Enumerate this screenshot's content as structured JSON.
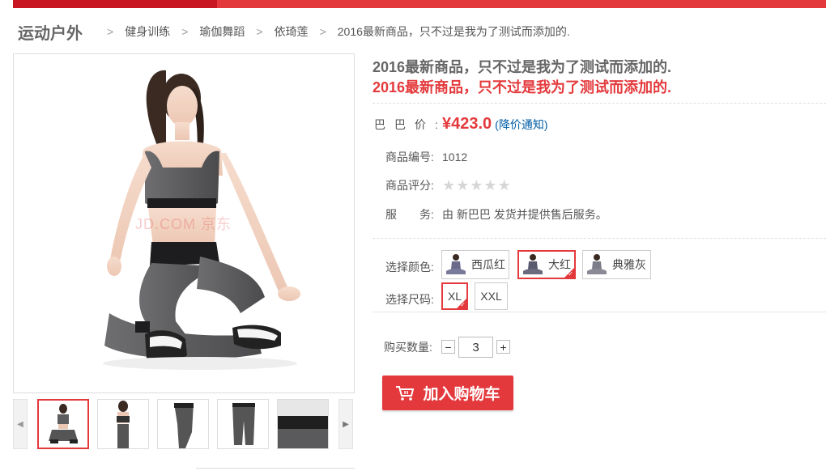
{
  "breadcrumb": {
    "root": "运动户外",
    "items": [
      "健身训练",
      "瑜伽舞蹈",
      "依琦莲",
      "2016最新商品，只不过是我为了测试而添加的."
    ]
  },
  "product": {
    "title_gray": "2016最新商品，只不过是我为了测试而添加的.",
    "title_red": "2016最新商品，只不过是我为了测试而添加的.",
    "price_label": "巴巴价:",
    "price": "¥423.0",
    "price_notify": "(降价通知)",
    "sku_label": "商品编号:",
    "sku": "1012",
    "rating_label": "商品评分:",
    "rating": 0,
    "rating_max": 5,
    "service_label": "服　　务:",
    "service": "由 新巴巴 发货并提供售后服务。",
    "watermark": "JD.COM 京东"
  },
  "colors": {
    "label": "选择颜色:",
    "options": [
      {
        "label": "西瓜红",
        "selected": false
      },
      {
        "label": "大红",
        "selected": true
      },
      {
        "label": "典雅灰",
        "selected": false
      }
    ]
  },
  "sizes": {
    "label": "选择尺码:",
    "options": [
      {
        "label": "XL",
        "selected": true
      },
      {
        "label": "XXL",
        "selected": false
      }
    ]
  },
  "quantity": {
    "label": "购买数量:",
    "value": "3",
    "minus": "−",
    "plus": "+"
  },
  "cart_button": "加入购物车",
  "thumbnails": [
    "front-pose",
    "back-view",
    "leggings-side",
    "leggings-front",
    "waistband-closeup"
  ],
  "accent_color": "#e4393c"
}
